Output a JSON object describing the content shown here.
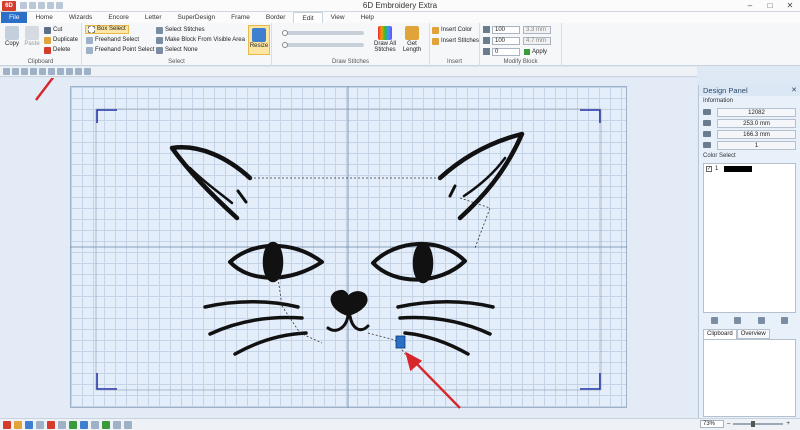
{
  "window": {
    "title": "6D Embroidery Extra",
    "app_badge": "6D",
    "minimize": "–",
    "maximize": "□",
    "close": "✕"
  },
  "tabs": [
    "File",
    "Home",
    "Wizards",
    "Encore",
    "Letter",
    "SuperDesign",
    "Frame",
    "Border",
    "Edit",
    "View",
    "Help"
  ],
  "active_tab": "Edit",
  "ribbon": {
    "clipboard": {
      "label": "Clipboard",
      "copy": "Copy",
      "paste": "Paste",
      "cut": "Cut",
      "duplicate": "Duplicate",
      "delete": "Delete"
    },
    "select": {
      "label": "Select",
      "box_select": "Box Select",
      "freehand_select": "Freehand Select",
      "freehand_point_select": "Freehand Point Select",
      "select_stitches": "Select Stitches",
      "make_block": "Make Block From Visible Area",
      "select_none": "Select None",
      "resize": "Resize"
    },
    "draw_stitches": {
      "label": "Draw Stitches",
      "draw_all": "Draw All Stitches",
      "get_length": "Get Length"
    },
    "insert": {
      "label": "Insert",
      "insert_color": "Insert Color",
      "insert_stitches": "Insert Stitches"
    },
    "modify_block": {
      "label": "Modify Block",
      "width_pct": "100",
      "width_mm": "3.3 mm",
      "height_pct": "100",
      "height_mm": "4.7 mm",
      "rotation": "0",
      "apply": "Apply"
    }
  },
  "design_panel": {
    "title": "Design Panel",
    "close": "✕",
    "information_label": "Information",
    "stitches": "12082",
    "width": "253.0 mm",
    "height": "166.3 mm",
    "colors": "1",
    "color_select_label": "Color Select",
    "color_items": [
      {
        "number": "1",
        "color": "#000000",
        "checked": true
      }
    ],
    "tabs": [
      "Clipboard",
      "Overview"
    ]
  },
  "status": {
    "zoom": "73%"
  },
  "colors": {
    "accent": "#2b6fc6",
    "arrow": "#d9262c",
    "stitch": "#111111",
    "frame_corner": "#1f2fb0",
    "highlight": "#fde6a3"
  }
}
